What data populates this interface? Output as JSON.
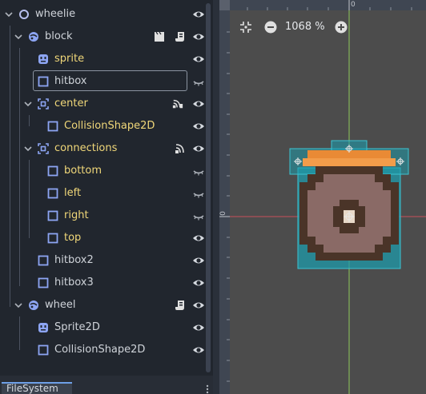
{
  "scene_tree": {
    "nodes": [
      {
        "label": "wheelie",
        "color": "white"
      },
      {
        "label": "block",
        "color": "white"
      },
      {
        "label": "sprite",
        "color": "yellow"
      },
      {
        "label": "hitbox",
        "color": "white"
      },
      {
        "label": "center",
        "color": "yellow"
      },
      {
        "label": "CollisionShape2D",
        "color": "yellow"
      },
      {
        "label": "connections",
        "color": "yellow"
      },
      {
        "label": "bottom",
        "color": "yellow"
      },
      {
        "label": "left",
        "color": "yellow"
      },
      {
        "label": "right",
        "color": "yellow"
      },
      {
        "label": "top",
        "color": "yellow"
      },
      {
        "label": "hitbox2",
        "color": "white"
      },
      {
        "label": "hitbox3",
        "color": "white"
      },
      {
        "label": "wheel",
        "color": "white"
      },
      {
        "label": "Sprite2D",
        "color": "white"
      },
      {
        "label": "CollisionShape2D",
        "color": "white"
      }
    ]
  },
  "dock": {
    "filesystem_tab": "FileSystem"
  },
  "viewport": {
    "zoom_label": "1068 %",
    "ruler_top_origin": "0",
    "ruler_left_origin": "0"
  },
  "colors": {
    "accent": "#6ea0e8",
    "node_yellow": "#f0d779",
    "node_white": "#cfd3d9",
    "collision_cyan": "#1e9aaa",
    "axis_red": "#c8505a",
    "axis_green": "#8ec85a"
  }
}
